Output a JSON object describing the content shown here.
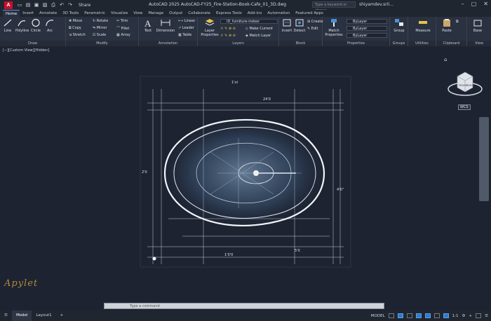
{
  "app": {
    "logo": "A",
    "title": "AutoCAD 2025   AutoCAD-FY25_Fire-Station-Book-Cafe_01_3D.dwg",
    "share": "Share",
    "search_placeholder": "Type a keyword or phrase",
    "user": "shiyamdev.sril..."
  },
  "ribbon_tabs": [
    "Home",
    "Insert",
    "Annotate",
    "3D Tools",
    "Parametric",
    "Visualize",
    "View",
    "Manage",
    "Output",
    "Collaborate",
    "Express Tools",
    "Add-ins",
    "Automation",
    "Featured Apps"
  ],
  "ribbon": {
    "draw": {
      "label": "Draw",
      "line": "Line",
      "polyline": "Polyline",
      "circle": "Circle",
      "arc": "Arc"
    },
    "modify": {
      "label": "Modify",
      "move": "Move",
      "rotate": "Rotate",
      "trim": "Trim",
      "copy": "Copy",
      "mirror": "Mirror",
      "fillet": "Fillet",
      "stretch": "Stretch",
      "scale": "Scale",
      "array": "Array"
    },
    "annotation": {
      "label": "Annotation",
      "text": "Text",
      "dimension": "Dimension",
      "linear": "Linear",
      "leader": "Leader",
      "table": "Table"
    },
    "layers": {
      "label": "Layers",
      "layer_properties": "Layer Properties",
      "current_layer": "ID_furniture-indoor",
      "make_current": "Make Current",
      "match_layer": "Match Layer"
    },
    "block": {
      "label": "Block",
      "insert": "Insert",
      "detect": "Detect",
      "create": "Create",
      "edit": "Edit"
    },
    "properties": {
      "label": "Properties",
      "match_properties": "Match Properties",
      "color": "ByLayer",
      "linetype": "ByLayer",
      "lineweight": "ByLayer"
    },
    "groups": {
      "label": "Groups",
      "group": "Group"
    },
    "utilities": {
      "label": "Utilities",
      "measure": "Measure"
    },
    "clipboard": {
      "label": "Clipboard",
      "paste": "Paste"
    },
    "view": {
      "label": "View",
      "base": "Base"
    }
  },
  "viewport": {
    "label": "[−][Custom View][Hidden]",
    "wcs": "WCS",
    "viewcube_front": "FRONT",
    "viewcube_right": "RIGHT",
    "watermark": "Apylet"
  },
  "drawing_labels": {
    "top1": "1'ol",
    "top2": "24'0",
    "left1": "2'0",
    "right1": "4'6\"",
    "bottom1": "1'0'0",
    "bottom2": "5'0"
  },
  "command": {
    "placeholder": "Type a command"
  },
  "status": {
    "tabs": [
      "Model",
      "Layout1"
    ],
    "model_label": "MODEL",
    "scale": "1:1"
  }
}
